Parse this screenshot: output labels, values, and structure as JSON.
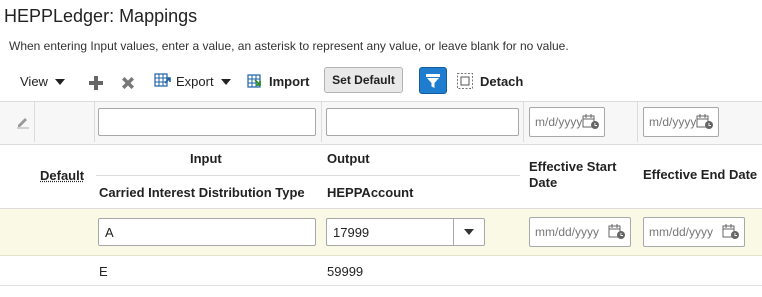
{
  "page": {
    "title": "HEPPLedger: Mappings",
    "instructions": "When entering Input values, enter a value, an asterisk to represent any value, or leave blank for no value."
  },
  "toolbar": {
    "view_label": "View",
    "export_label": "Export",
    "import_label": "Import",
    "set_default_label": "Set Default",
    "detach_label": "Detach"
  },
  "filters": {
    "input_value": "",
    "output_value": "",
    "start_date_placeholder": "m/d/yyyy",
    "end_date_placeholder": "m/d/yyyy"
  },
  "table": {
    "columns": {
      "default": "Default",
      "input_group": "Input",
      "input_sub": "Carried Interest Distribution Type",
      "output_group": "Output",
      "output_sub": "HEPPAccount",
      "start_date": "Effective Start Date",
      "end_date": "Effective End Date"
    },
    "rows": [
      {
        "input": "A",
        "output": "17999",
        "start_placeholder": "mm/dd/yyyy",
        "end_placeholder": "mm/dd/yyyy",
        "selected": true
      },
      {
        "input": "E",
        "output": "59999"
      }
    ]
  },
  "colors": {
    "accent": "#1f7dd0",
    "selected_row": "#f9f9e6"
  }
}
